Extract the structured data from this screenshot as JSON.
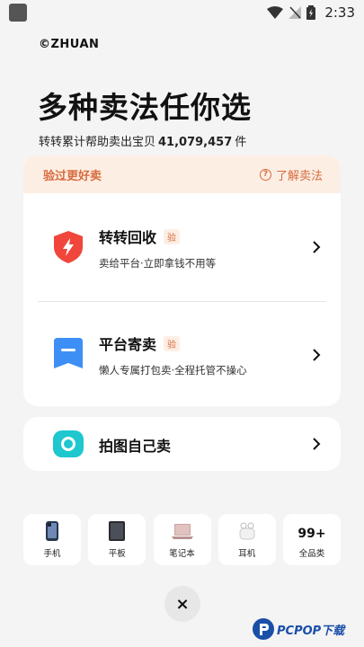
{
  "status_bar": {
    "time": "2:33"
  },
  "brand": "©ZHUAN",
  "headline": "多种卖法任你选",
  "subline": {
    "prefix": "转转累计帮助卖出宝贝",
    "count": "41,079,457",
    "suffix": "件"
  },
  "main_card": {
    "header_left": "验过更好卖",
    "header_right": "了解卖法",
    "header_right_icon": "question-circle-icon",
    "services": [
      {
        "title": "转转回收",
        "badge": "验",
        "desc": "卖给平台·立即拿钱不用等",
        "icon": "shield-lightning-icon",
        "color": "#f0463c"
      },
      {
        "title": "平台寄卖",
        "badge": "验",
        "desc": "懒人专属打包卖·全程托管不操心",
        "icon": "bookmark-card-icon",
        "color": "#3d8ff6"
      }
    ]
  },
  "photo_card": {
    "title": "拍图自己卖",
    "icon": "camera-icon",
    "color": "#1fc7cf"
  },
  "categories": [
    {
      "label": "手机",
      "icon": "phone-icon"
    },
    {
      "label": "平板",
      "icon": "tablet-icon"
    },
    {
      "label": "笔记本",
      "icon": "laptop-icon"
    },
    {
      "label": "耳机",
      "icon": "earbuds-icon"
    },
    {
      "label": "全品类",
      "more": "99+"
    }
  ],
  "close_label": "×",
  "watermark": "PCPOP下载",
  "colors": {
    "accent": "#d76b3c",
    "header_bg": "#fdeee4",
    "page_bg": "#f4f4f4"
  }
}
